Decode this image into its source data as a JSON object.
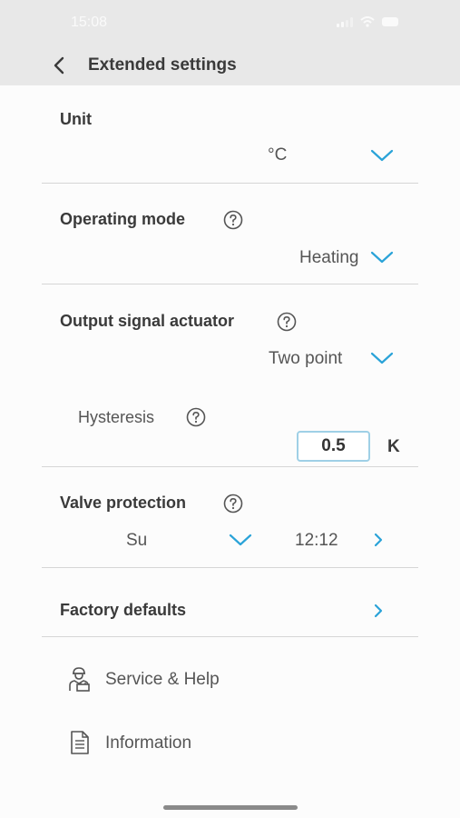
{
  "status_bar": {
    "time": "15:08"
  },
  "header": {
    "title": "Extended settings"
  },
  "unit": {
    "label": "Unit",
    "value": "°C"
  },
  "operating_mode": {
    "label": "Operating mode",
    "value": "Heating"
  },
  "output_signal": {
    "label": "Output signal actuator",
    "value": "Two point",
    "hysteresis": {
      "label": "Hysteresis",
      "value": "0.5",
      "unit": "K"
    }
  },
  "valve_protection": {
    "label": "Valve protection",
    "day": "Su",
    "time": "12:12"
  },
  "factory_defaults": {
    "label": "Factory defaults"
  },
  "menu": [
    {
      "label": "Service & Help",
      "icon": "service-technician-icon"
    },
    {
      "label": "Information",
      "icon": "document-icon"
    }
  ],
  "colors": {
    "accent": "#2aa3d8",
    "header_bg": "#e8e8e8",
    "input_border": "#9fd0e6"
  }
}
